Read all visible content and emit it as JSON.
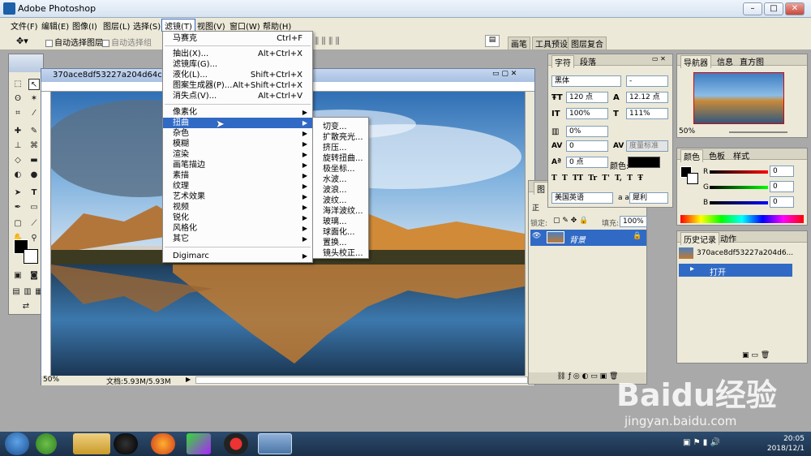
{
  "app": {
    "title": "Adobe Photoshop"
  },
  "menubar": {
    "items": [
      "文件(F)",
      "编辑(E)",
      "图像(I)",
      "图层(L)",
      "选择(S)",
      "滤镜(T)",
      "视图(V)",
      "窗口(W)",
      "帮助(H)"
    ]
  },
  "options": {
    "auto_select_layer": "自动选择图层",
    "auto_select_group": "自动选择组",
    "tabs": [
      "画笔",
      "工具预设",
      "图层复合"
    ]
  },
  "document": {
    "title": "370ace8df53227a204d64c76eb",
    "zoom": "50%",
    "doc_info": "文档:5.93M/5.93M"
  },
  "filter_menu": {
    "items": [
      {
        "label": "马赛克",
        "shortcut": "Ctrl+F"
      },
      {
        "label": "抽出(X)...",
        "shortcut": "Alt+Ctrl+X"
      },
      {
        "label": "滤镜库(G)...",
        "shortcut": ""
      },
      {
        "label": "液化(L)...",
        "shortcut": "Shift+Ctrl+X"
      },
      {
        "label": "图案生成器(P)...",
        "shortcut": "Alt+Shift+Ctrl+X"
      },
      {
        "label": "消失点(V)...",
        "shortcut": "Alt+Ctrl+V"
      },
      {
        "label": "像素化",
        "shortcut": ""
      },
      {
        "label": "扭曲",
        "shortcut": ""
      },
      {
        "label": "杂色",
        "shortcut": ""
      },
      {
        "label": "模糊",
        "shortcut": ""
      },
      {
        "label": "渲染",
        "shortcut": ""
      },
      {
        "label": "画笔描边",
        "shortcut": ""
      },
      {
        "label": "素描",
        "shortcut": ""
      },
      {
        "label": "纹理",
        "shortcut": ""
      },
      {
        "label": "艺术效果",
        "shortcut": ""
      },
      {
        "label": "视频",
        "shortcut": ""
      },
      {
        "label": "锐化",
        "shortcut": ""
      },
      {
        "label": "风格化",
        "shortcut": ""
      },
      {
        "label": "其它",
        "shortcut": ""
      },
      {
        "label": "Digimarc",
        "shortcut": ""
      }
    ]
  },
  "distort_submenu": {
    "items": [
      "切变...",
      "扩散亮光...",
      "挤压...",
      "旋转扭曲...",
      "极坐标...",
      "水波...",
      "波浪...",
      "波纹...",
      "海洋波纹...",
      "玻璃...",
      "球面化...",
      "置换...",
      "镜头校正..."
    ]
  },
  "character_panel": {
    "tabs": [
      "字符",
      "段落"
    ],
    "font": "黑体",
    "style": "-",
    "size": "120 点",
    "leading": "12.12 点",
    "vscale": "100%",
    "hscale": "111%",
    "tracking_pct": "0%",
    "kerning": "0",
    "tracking_label": "度量标准",
    "baseline": "0 点",
    "color_label": "颜色:",
    "language": "美国英语",
    "aa_label": "a a",
    "antialias": "犀利",
    "style_buttons": [
      "T",
      "T",
      "TT",
      "Tr",
      "T'",
      "T,",
      "T",
      "Ŧ"
    ]
  },
  "layers_panel": {
    "tab": "图",
    "mode": "正",
    "lock_label": "锁定:",
    "fill_label": "填充:",
    "fill_value": "100%",
    "layer_name": "背景"
  },
  "navigator_panel": {
    "tabs": [
      "导航器",
      "信息",
      "直方图"
    ],
    "zoom": "50%"
  },
  "color_panel": {
    "tabs": [
      "颜色",
      "色板",
      "样式"
    ],
    "r_label": "R",
    "r": "0",
    "g_label": "G",
    "g": "0",
    "b_label": "B",
    "b": "0"
  },
  "history_panel": {
    "tabs": [
      "历史记录",
      "动作"
    ],
    "snapshot": "370ace8df53227a204d6...",
    "items": [
      "打开"
    ]
  },
  "taskbar": {
    "time": "20:05",
    "date": "2018/12/1"
  },
  "watermark": {
    "text": "Baidu经验",
    "url": "jingyan.baidu.com"
  }
}
